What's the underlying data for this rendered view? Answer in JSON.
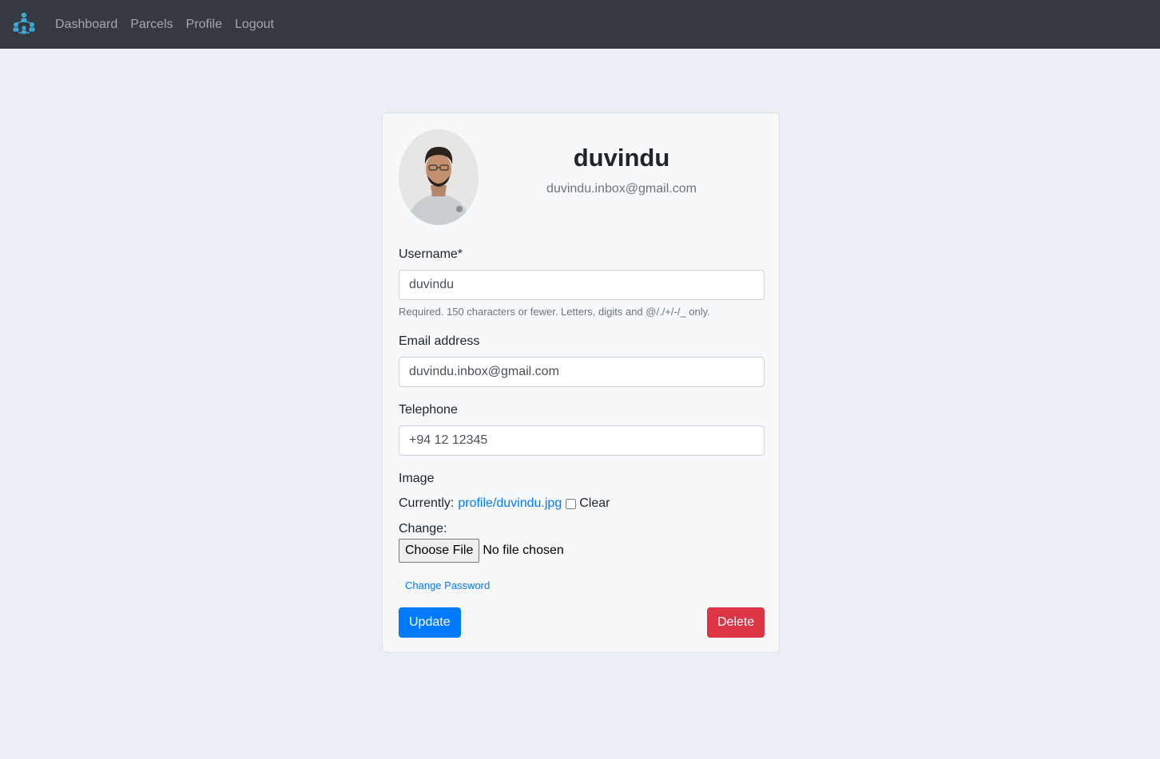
{
  "nav": {
    "brand_icon": "network-logo-icon",
    "links": [
      "Dashboard",
      "Parcels",
      "Profile",
      "Logout"
    ]
  },
  "profile": {
    "name": "duvindu",
    "email": "duvindu.inbox@gmail.com",
    "avatar_icon": "user-photo"
  },
  "form": {
    "username_label": "Username*",
    "username_value": "duvindu",
    "username_help": "Required. 150 characters or fewer. Letters, digits and @/./+/-/_ only.",
    "email_label": "Email address",
    "email_value": "duvindu.inbox@gmail.com",
    "telephone_label": "Telephone",
    "telephone_value": "+94 12 12345",
    "image_label": "Image",
    "currently_label": "Currently:",
    "current_file": "profile/duvindu.jpg",
    "clear_label": "Clear",
    "change_label": "Change:",
    "choose_file_label": "Choose File",
    "no_file_text": "No file chosen",
    "change_password_link": "Change Password",
    "update_button": "Update",
    "delete_button": "Delete"
  },
  "colors": {
    "navbar": "#343a40",
    "primary": "#007bff",
    "danger": "#dc3545",
    "page_bg": "#ebeef5",
    "brand_icon": "#3fa7d6"
  }
}
